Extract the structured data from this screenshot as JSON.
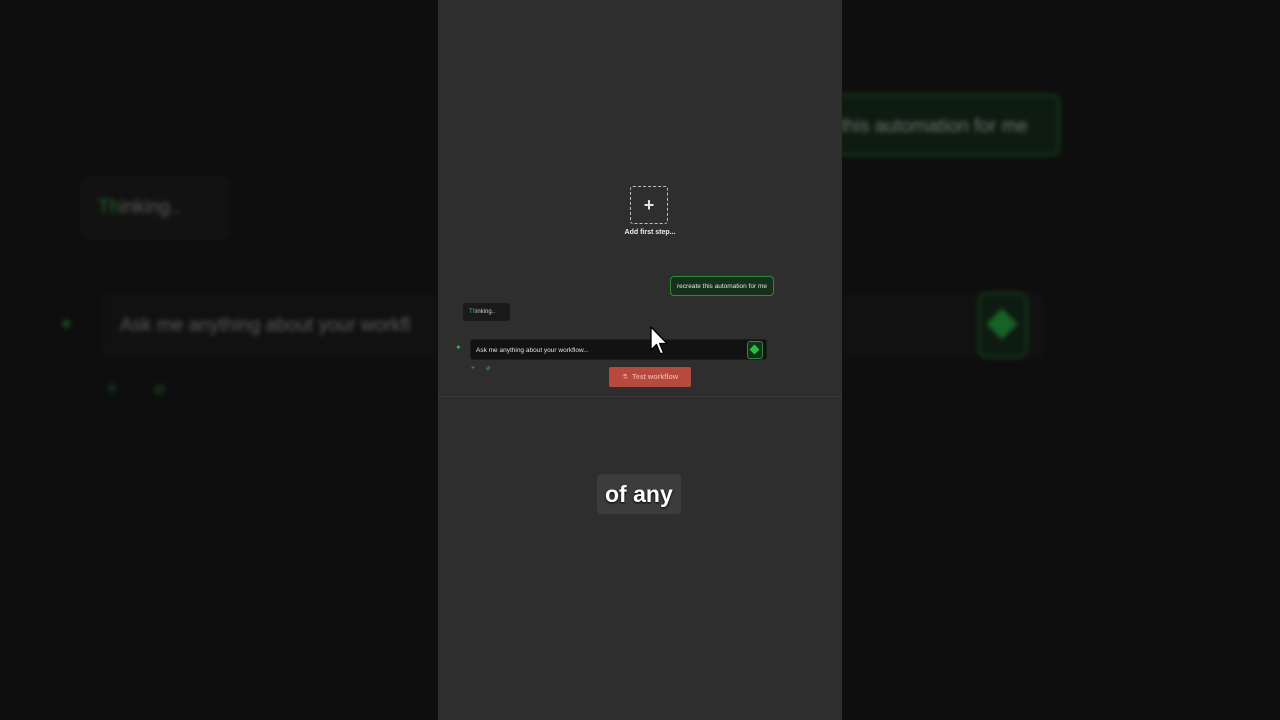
{
  "canvas": {
    "add_step_label": "Add first step...",
    "add_step_symbol": "+"
  },
  "chat": {
    "user_message": "recreate this automation for me",
    "thinking_text_green": "Th",
    "thinking_text_rest": "inking..",
    "input_placeholder": "Ask me anything about your workflow...",
    "test_button_label": "Test workflow"
  },
  "backdrop": {
    "user_message": "this automation for me",
    "thinking_text_green": "Th",
    "thinking_text_rest": "inking..",
    "input_placeholder": "Ask me anything about your workfl"
  },
  "caption": "of any",
  "colors": {
    "accent_green": "#2fb24c",
    "test_button": "#b64a3e",
    "panel_bg": "#2e2e2e"
  },
  "icons": {
    "send": "diamond-icon",
    "assistant": "sparkle-icon",
    "attach": "paperclip-icon",
    "add": "plus-icon",
    "test": "flask-icon"
  }
}
